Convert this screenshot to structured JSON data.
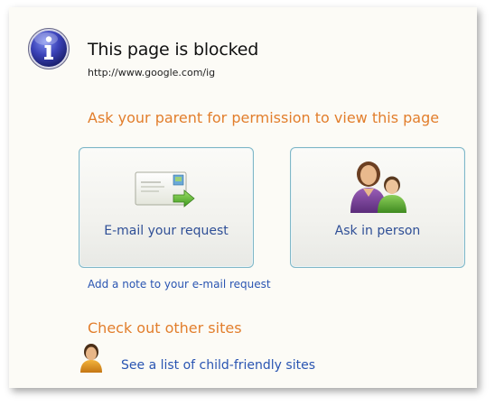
{
  "header": {
    "title": "This page is blocked",
    "url": "http://www.google.com/ig"
  },
  "permission": {
    "heading": "Ask your parent for permission to view this page",
    "email_option": {
      "label": "E-mail your request",
      "icon": "email-envelope-icon"
    },
    "person_option": {
      "label": "Ask in person",
      "icon": "parent-and-child-icon"
    },
    "add_note_link": "Add a note to your e-mail request"
  },
  "other_sites": {
    "heading": "Check out other sites",
    "link": "See a list of child-friendly sites",
    "icon": "child-user-icon"
  },
  "colors": {
    "heading_orange": "#e27e2c",
    "link_blue": "#2a55b2",
    "panel_bg": "#fcfbf6",
    "button_border": "#7fb7c7"
  }
}
